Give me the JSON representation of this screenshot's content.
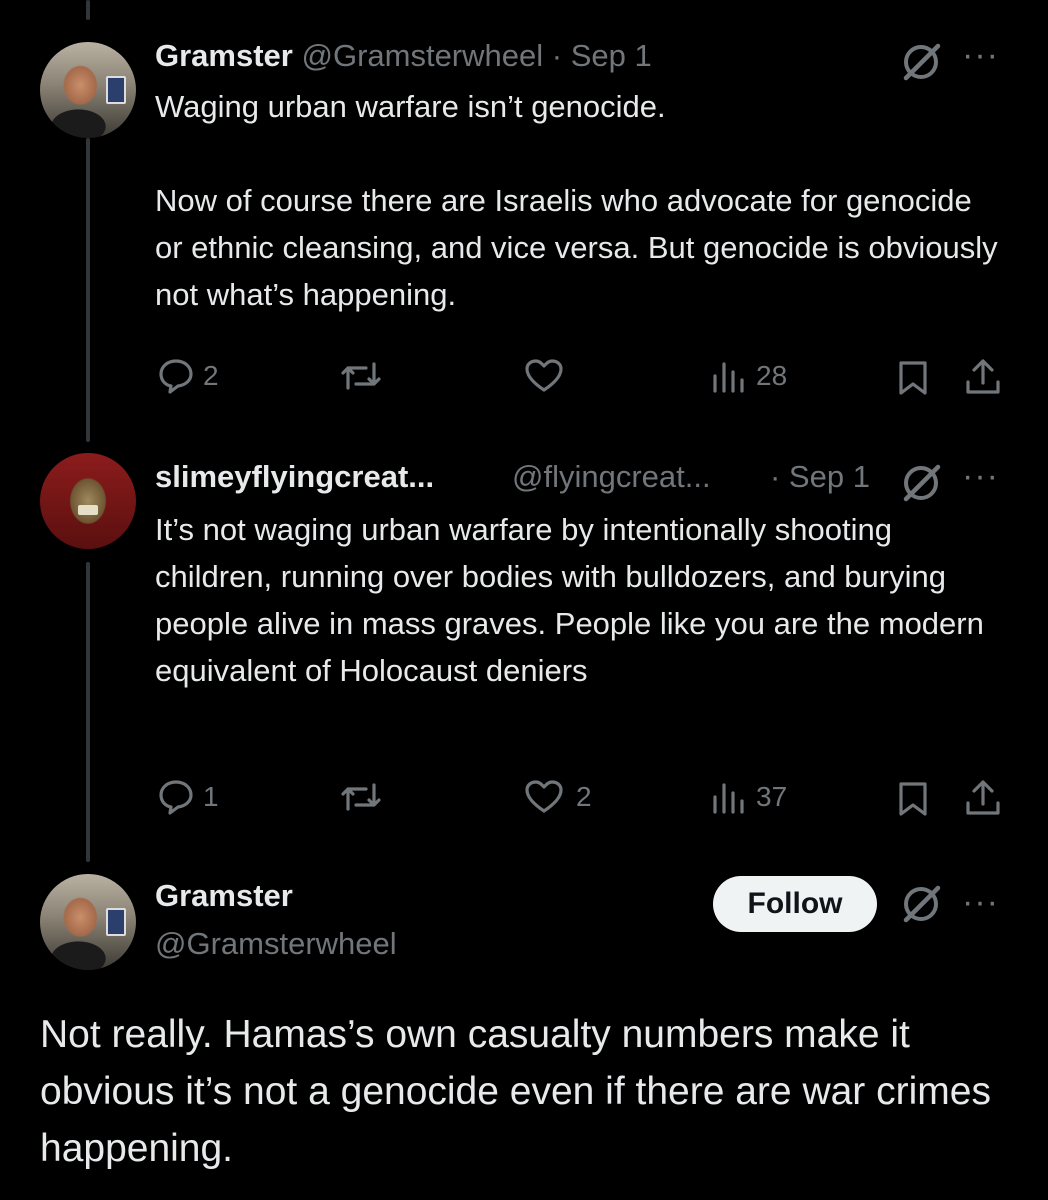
{
  "tweets": [
    {
      "display_name": "Gramster",
      "handle": "@Gramsterwheel",
      "date": "· Sep 1",
      "text": "Waging urban warfare isn’t genocide.\n\nNow of course there are Israelis who advocate for genocide or ethnic cleansing, and vice versa. But genocide is obviously not what’s happening.",
      "replies": "2",
      "retweets": "",
      "likes": "",
      "views": "28"
    },
    {
      "display_name": "slimeyflyingcreat...",
      "handle": "@flyingcreat...",
      "date": "· Sep 1",
      "text": "It’s not waging urban warfare by intentionally shooting children, running over bodies with bulldozers, and burying people alive in mass graves. People like you are the modern equivalent of Holocaust deniers",
      "replies": "1",
      "retweets": "",
      "likes": "2",
      "views": "37"
    }
  ],
  "main_tweet": {
    "display_name": "Gramster",
    "handle": "@Gramsterwheel",
    "follow_label": "Follow",
    "text": "Not really. Hamas’s own casualty numbers make it obvious it’s not a genocide even if there are war crimes happening."
  },
  "more_glyph": "···",
  "icons": {
    "reply": "reply-icon",
    "retweet": "retweet-icon",
    "like": "heart-icon",
    "views": "views-icon",
    "bookmark": "bookmark-icon",
    "share": "share-icon",
    "grok": "grok-icon"
  },
  "colors": {
    "background": "#000000",
    "text": "#e7e9ea",
    "muted": "#71767b",
    "follow_bg": "#eff3f4"
  }
}
